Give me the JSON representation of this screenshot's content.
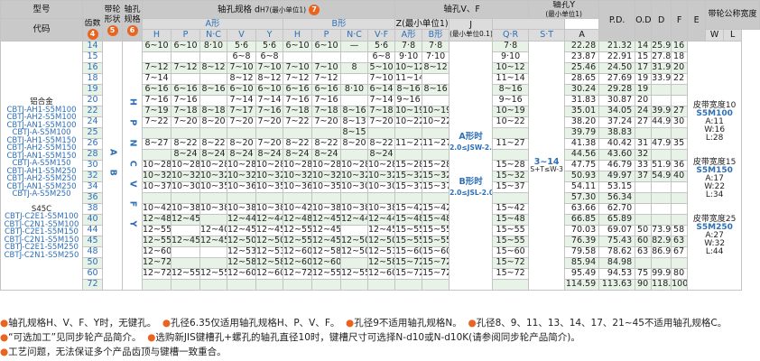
{
  "header": {
    "model_label": "型号",
    "code_label": "代码",
    "teeth_label": "齿数",
    "teeth_num": "4",
    "belt_shape_label": "带轮形状",
    "belt_shape_num": "5",
    "bore_spec_label": "轴孔规格",
    "bore_spec_num": "6",
    "bore_d_label": "轴孔规格 d",
    "bore_d_sub": "H7(最小单位1)",
    "bore_d_num": "7",
    "group_a": "A形",
    "group_b": "B形",
    "cols_h": "H",
    "cols_p": "P",
    "cols_nc": "N·C",
    "cols_v": "V",
    "cols_y": "Y",
    "cols_vf": "V·F",
    "bore_vf_label": "轴孔V、F",
    "z_label": "Z(最小单位1)",
    "z_a": "A形",
    "z_b": "B形",
    "j_label": "J",
    "j_sub": "(最小单位0.1)",
    "bore_y_label": "轴孔Y",
    "bore_y_sub": "(最小单位1)",
    "qr": "Q·R",
    "st": "S·T",
    "pd": "P.D.",
    "od": "O.D.",
    "d": "D",
    "f": "F",
    "e": "E",
    "belt_width_label": "带轮公称宽度",
    "bw_a": "A",
    "bw_w": "W",
    "bw_l": "L"
  },
  "codes": {
    "material_al": "铝合金",
    "al_codes": [
      "CBTJ-AH1-S5M100",
      "CBTJ-AH2-S5M100",
      "CBTJ-AN1-S5M100",
      "CBTJ-A-S5M100",
      "CBTJ-AH1-S5M150",
      "CBTJ-AH2-S5M150",
      "CBTJ-AN1-S5M150",
      "CBTJ-A-S5M150",
      "CBTJ-AH1-S5M250",
      "CBTJ-AH2-S5M250",
      "CBTJ-AN1-S5M250",
      "CBTJ-A-S5M250"
    ],
    "material_steel": "S45C",
    "steel_codes": [
      "CBTJ-C2E1-S5M100",
      "CBTJ-C2N1-S5M100",
      "CBTJ-C2E1-S5M150",
      "CBTJ-C2N1-S5M150",
      "CBTJ-C2E1-S5M250",
      "CBTJ-C2N1-S5M250"
    ]
  },
  "shape_letters": "A B",
  "bore_letters": "H P N C V F Y",
  "z_text": {
    "a": "A形时",
    "a_sub": "2.0≤JSW-2.0",
    "b": "B形时",
    "b_sub": "2.0≤JSL-2.0"
  },
  "st_text": {
    "range": "3~14",
    "sub": "S+T≤W-3"
  },
  "belt_widths": [
    {
      "title": "皮带宽度10",
      "code": "S5M100",
      "a": "A:11",
      "w": "W:16",
      "l": "L:28"
    },
    {
      "title": "皮带宽度15",
      "code": "S5M150",
      "a": "A:17",
      "w": "W:22",
      "l": "L:34"
    },
    {
      "title": "皮带宽度25",
      "code": "S5M250",
      "a": "A:27",
      "w": "W:32",
      "l": "L:44"
    }
  ],
  "rows": [
    {
      "t": "14",
      "pd": "22.28",
      "od": "21.32",
      "d": "14",
      "f": "25.9",
      "e": "16"
    },
    {
      "t": "15",
      "pd": "23.87",
      "od": "22.91",
      "d": "15",
      "f": "27.8",
      "e": "18"
    },
    {
      "t": "16",
      "pd": "25.46",
      "od": "24.50",
      "d": "17",
      "f": "31.9",
      "e": "20"
    },
    {
      "t": "18",
      "pd": "28.65",
      "od": "27.69",
      "d": "19",
      "f": "33.9",
      "e": "22"
    },
    {
      "t": "19",
      "pd": "30.24",
      "od": "29.28",
      "d": "19",
      "f": "",
      "e": ""
    },
    {
      "t": "20",
      "pd": "31.83",
      "od": "30.87",
      "d": "20",
      "f": "",
      "e": ""
    },
    {
      "t": "22",
      "pd": "35.01",
      "od": "34.05",
      "d": "24",
      "f": "39.9",
      "e": "27"
    },
    {
      "t": "24",
      "pd": "38.20",
      "od": "37.24",
      "d": "27",
      "f": "44.9",
      "e": "30"
    },
    {
      "t": "25",
      "pd": "39.79",
      "od": "38.83",
      "d": "",
      "f": "",
      "e": ""
    },
    {
      "t": "26",
      "pd": "41.38",
      "od": "40.42",
      "d": "31",
      "f": "47.9",
      "e": "35"
    },
    {
      "t": "28",
      "pd": "44.56",
      "od": "43.60",
      "d": "32",
      "f": "",
      "e": ""
    },
    {
      "t": "30",
      "pd": "47.75",
      "od": "46.79",
      "d": "33",
      "f": "51.9",
      "e": "36"
    },
    {
      "t": "32",
      "pd": "50.93",
      "od": "49.97",
      "d": "37",
      "f": "54.9",
      "e": "40"
    },
    {
      "t": "34",
      "pd": "54.11",
      "od": "53.15",
      "d": "",
      "f": "",
      "e": ""
    },
    {
      "t": "36",
      "pd": "57.30",
      "od": "56.34",
      "d": "",
      "f": "",
      "e": ""
    },
    {
      "t": "38",
      "pd": "63.66",
      "od": "62.70",
      "d": "",
      "f": "",
      "e": ""
    },
    {
      "t": "40",
      "pd": "66.85",
      "od": "65.89",
      "d": "",
      "f": "",
      "e": ""
    },
    {
      "t": "44",
      "pd": "70.03",
      "od": "69.07",
      "d": "50",
      "f": "73.9",
      "e": "58"
    },
    {
      "t": "45",
      "pd": "76.39",
      "od": "75.43",
      "d": "60",
      "f": "82.9",
      "e": "63"
    },
    {
      "t": "48",
      "pd": "79.58",
      "od": "78.62",
      "d": "63",
      "f": "86.9",
      "e": "67"
    },
    {
      "t": "50",
      "pd": "85.94",
      "od": "84.98",
      "d": "",
      "f": "",
      "e": ""
    },
    {
      "t": "60",
      "pd": "95.49",
      "od": "94.53",
      "d": "75",
      "f": "99.9",
      "e": "80"
    },
    {
      "t": "72",
      "pd": "114.59",
      "od": "113.63",
      "d": "90",
      "f": "118.9",
      "e": "100"
    }
  ],
  "bores": [
    [
      "6~10",
      "6~10",
      "8·10",
      "5·6",
      "5·6",
      "6~10",
      "6~10",
      "—",
      "5·6",
      "7·8",
      "7·8",
      "7·8"
    ],
    [
      "",
      "",
      "",
      "6~8",
      "6~8",
      "",
      "",
      "",
      "6~8",
      "9·10",
      "7·10",
      "9·10"
    ],
    [
      "7~12",
      "7~12",
      "8~12",
      "7~10",
      "7~10",
      "7~10",
      "7~10",
      "8",
      "5~10",
      "10~12",
      "8~12",
      "10~12"
    ],
    [
      "7~14",
      "",
      "",
      "8~12",
      "8~12",
      "7~12",
      "7~12",
      "",
      "7~10",
      "11~14",
      "",
      "11~14"
    ],
    [
      "6~16",
      "6~16",
      "8~16",
      "6~10",
      "6~10",
      "6~16",
      "6~16",
      "8·10",
      "6~14",
      "8~16",
      "8~16",
      "8~16"
    ],
    [
      "7~16",
      "7~16",
      "",
      "7~14",
      "7~14",
      "7~16",
      "7~16",
      "",
      "7~14",
      "9~16",
      "",
      "9~16"
    ],
    [
      "7~19",
      "7~18",
      "8~18",
      "7~17",
      "7~16",
      "7~18",
      "7~18",
      "8~16",
      "7~18",
      "10~19",
      "10~19",
      "10~19"
    ],
    [
      "7~22",
      "7~20",
      "8~20",
      "7~20",
      "7~20",
      "7~22",
      "7~20",
      "8~13",
      "7~20",
      "10~22",
      "10~22",
      "10~22"
    ],
    [
      "",
      "",
      "",
      "",
      "",
      "",
      "",
      "8~15",
      "",
      "",
      "",
      ""
    ],
    [
      "8~27",
      "8~22",
      "8~22",
      "8~20",
      "7~20",
      "8~22",
      "8~22",
      "8~20",
      "8~22",
      "11~27",
      "11~27",
      "11~27"
    ],
    [
      "",
      "8~24",
      "8~24",
      "8~24",
      "8~24",
      "8~24",
      "8~24",
      "",
      "8~24",
      "",
      "",
      ""
    ],
    [
      "10~28",
      "10~28",
      "10~28",
      "10~28",
      "10~28",
      "10~28",
      "10~28",
      "10~28",
      "10~28",
      "15~28",
      "15~28",
      "15~28"
    ],
    [
      "10~32",
      "10~32",
      "10~32",
      "10~32",
      "10~32",
      "10~32",
      "10~32",
      "10~32",
      "10~32",
      "15~32",
      "15~32",
      "15~32"
    ],
    [
      "10~37",
      "10~30",
      "10~35",
      "10~36",
      "10~35",
      "10~36",
      "10~35",
      "10~30",
      "10~30",
      "15~37",
      "15~37",
      "15~37"
    ],
    [
      "",
      "",
      "",
      "",
      "",
      "",
      "",
      "",
      "",
      "",
      "",
      ""
    ],
    [
      "10~42",
      "10~38",
      "10~38",
      "10~38",
      "10~38",
      "10~42",
      "10~38",
      "10~38",
      "10~38",
      "15~42",
      "15~42",
      "15~42"
    ],
    [
      "12~48",
      "12~45",
      "",
      "12~44",
      "12~44",
      "12~48",
      "12~45",
      "12~44",
      "12~44",
      "15~48",
      "15~48",
      "15~48"
    ],
    [
      "12~55",
      "",
      "12~40",
      "12~45",
      "12~45",
      "12~55",
      "12~45",
      "",
      "12~45",
      "15~55",
      "15~55",
      "15~55"
    ],
    [
      "12~55",
      "12~45",
      "12~45",
      "12~50",
      "12~50",
      "12~55",
      "12~45",
      "12~50",
      "12~50",
      "15~55",
      "15~55",
      "15~55"
    ],
    [
      "12~60",
      "",
      "",
      "12~53",
      "12~53",
      "12~60",
      "12~58",
      "12~50",
      "12~53",
      "15~60",
      "15~60",
      "15~60"
    ],
    [
      "12~72",
      "",
      "",
      "12~58",
      "12~58",
      "12~60",
      "12~60",
      "",
      "12~58",
      "15~72",
      "15~72",
      "15~72"
    ],
    [
      "12~72",
      "12~55",
      "12~55",
      "12~60",
      "12~60",
      "12~72",
      "12~55",
      "12~55",
      "12~60",
      "15~72",
      "15~72",
      "15~72"
    ],
    [
      "",
      "",
      "",
      "",
      "",
      "",
      "",
      "",
      "",
      "",
      "",
      ""
    ]
  ],
  "notes": [
    "轴孔规格H、V、F、Y时，无键孔。",
    "孔径6.35仅适用轴孔规格H、P、V、F。",
    "孔径9不适用轴孔规格N。",
    "孔径8、9、11、13、14、17、21~45不适用轴孔规格C。",
    "“可选加工”见同步轮产品简介。",
    "选购新JIS键槽孔+螺孔的轴孔直径10时，键槽尺寸可选择N-d10或N-d10K(请参阅同步轮产品简介)。",
    "工艺问题，无法保证多个产品齿顶与键槽一致重合。"
  ]
}
